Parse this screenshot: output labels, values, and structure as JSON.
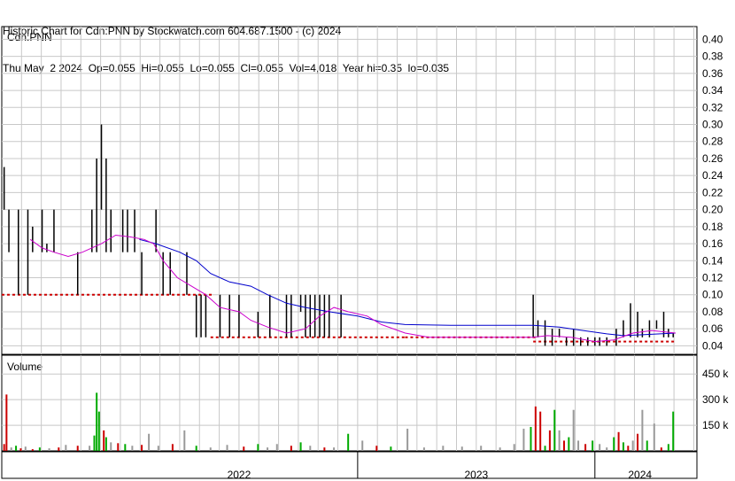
{
  "header": {
    "line1": "Historic Chart for Cdn:PNN by Stockwatch.com 604.687.1500 - (c) 2024",
    "line2": "Thu May  2 2024  Op=0.055  Hi=0.055  Lo=0.055  Cl=0.055  Vol=4,018  Year hi=0.35  lo=0.035"
  },
  "colors": {
    "grid": "#c8c8c8",
    "price_up": "#000000",
    "price_down": "#cc0000",
    "ma_short": "#cc00cc",
    "ma_long": "#0000cc",
    "vol_up": "#00aa00",
    "vol_down": "#cc0000",
    "vol_flat": "#999999"
  },
  "chart_data": [
    {
      "type": "line",
      "title": "Cdn:PNN",
      "y_ticks": [
        "0.40",
        "0.38",
        "0.36",
        "0.34",
        "0.32",
        "0.30",
        "0.28",
        "0.26",
        "0.24",
        "0.22",
        "0.20",
        "0.18",
        "0.16",
        "0.14",
        "0.12",
        "0.10",
        "0.08",
        "0.06",
        "0.04"
      ],
      "ylim": [
        0.03,
        0.415
      ],
      "xlim": [
        2021.5,
        2024.43
      ],
      "x_labels": [
        {
          "label": "2022",
          "center": 2022.5
        },
        {
          "label": "2023",
          "center": 2023.5
        },
        {
          "label": "2024",
          "center": 2024.19
        }
      ],
      "year_boundaries": [
        2023.0,
        2024.0
      ],
      "grid": true,
      "price_bars": [
        [
          2021.51,
          0.25,
          0.2
        ],
        [
          2021.53,
          0.2,
          0.15
        ],
        [
          2021.55,
          0.15,
          0.15
        ],
        [
          2021.57,
          0.2,
          0.1
        ],
        [
          2021.59,
          0.15,
          0.15
        ],
        [
          2021.61,
          0.2,
          0.1
        ],
        [
          2021.63,
          0.18,
          0.15
        ],
        [
          2021.65,
          0.15,
          0.15
        ],
        [
          2021.67,
          0.2,
          0.15
        ],
        [
          2021.69,
          0.16,
          0.15
        ],
        [
          2021.72,
          0.2,
          0.15
        ],
        [
          2021.74,
          0.15,
          0.15
        ],
        [
          2021.78,
          0.15,
          0.15
        ],
        [
          2021.82,
          0.15,
          0.1
        ],
        [
          2021.86,
          0.15,
          0.15
        ],
        [
          2021.88,
          0.2,
          0.15
        ],
        [
          2021.9,
          0.26,
          0.15
        ],
        [
          2021.92,
          0.3,
          0.2
        ],
        [
          2021.94,
          0.26,
          0.15
        ],
        [
          2021.96,
          0.2,
          0.15
        ],
        [
          2021.98,
          0.15,
          0.15
        ],
        [
          2022.01,
          0.2,
          0.15
        ],
        [
          2022.03,
          0.2,
          0.15
        ],
        [
          2022.06,
          0.2,
          0.15
        ],
        [
          2022.09,
          0.15,
          0.1
        ],
        [
          2022.12,
          0.15,
          0.15
        ],
        [
          2022.15,
          0.2,
          0.15
        ],
        [
          2022.18,
          0.15,
          0.1
        ],
        [
          2022.21,
          0.15,
          0.1
        ],
        [
          2022.24,
          0.15,
          0.15
        ],
        [
          2022.28,
          0.15,
          0.1
        ],
        [
          2022.32,
          0.1,
          0.05
        ],
        [
          2022.34,
          0.1,
          0.05
        ],
        [
          2022.36,
          0.1,
          0.05
        ],
        [
          2022.42,
          0.1,
          0.05
        ],
        [
          2022.46,
          0.1,
          0.05
        ],
        [
          2022.5,
          0.1,
          0.05
        ],
        [
          2022.58,
          0.08,
          0.05
        ],
        [
          2022.63,
          0.1,
          0.05
        ],
        [
          2022.7,
          0.1,
          0.05
        ],
        [
          2022.72,
          0.1,
          0.05
        ],
        [
          2022.76,
          0.1,
          0.08
        ],
        [
          2022.78,
          0.1,
          0.05
        ],
        [
          2022.8,
          0.1,
          0.05
        ],
        [
          2022.82,
          0.1,
          0.05
        ],
        [
          2022.84,
          0.1,
          0.05
        ],
        [
          2022.86,
          0.1,
          0.05
        ],
        [
          2022.88,
          0.1,
          0.05
        ],
        [
          2022.93,
          0.1,
          0.05
        ],
        [
          2023.74,
          0.1,
          0.05
        ],
        [
          2023.76,
          0.07,
          0.05
        ],
        [
          2023.79,
          0.07,
          0.04
        ],
        [
          2023.82,
          0.06,
          0.04
        ],
        [
          2023.85,
          0.06,
          0.05
        ],
        [
          2023.88,
          0.05,
          0.04
        ],
        [
          2023.91,
          0.06,
          0.04
        ],
        [
          2023.94,
          0.05,
          0.04
        ],
        [
          2023.97,
          0.05,
          0.04
        ],
        [
          2024.0,
          0.05,
          0.04
        ],
        [
          2024.02,
          0.05,
          0.04
        ],
        [
          2024.05,
          0.05,
          0.04
        ],
        [
          2024.09,
          0.06,
          0.04
        ],
        [
          2024.12,
          0.07,
          0.05
        ],
        [
          2024.15,
          0.09,
          0.05
        ],
        [
          2024.18,
          0.08,
          0.05
        ],
        [
          2024.2,
          0.06,
          0.05
        ],
        [
          2024.23,
          0.07,
          0.05
        ],
        [
          2024.26,
          0.07,
          0.06
        ],
        [
          2024.29,
          0.08,
          0.05
        ],
        [
          2024.31,
          0.06,
          0.05
        ],
        [
          2024.33,
          0.055,
          0.05
        ]
      ],
      "flat_closes": {
        "ranges": [
          [
            2021.5,
            2022.38,
            0.1
          ],
          [
            2022.38,
            2023.2,
            0.05
          ],
          [
            2023.2,
            2023.74,
            0.05
          ],
          [
            2023.74,
            2024.34,
            0.045
          ]
        ]
      },
      "ma_long": [
        [
          2022.08,
          0.165
        ],
        [
          2022.15,
          0.16
        ],
        [
          2022.25,
          0.15
        ],
        [
          2022.32,
          0.14
        ],
        [
          2022.38,
          0.125
        ],
        [
          2022.46,
          0.115
        ],
        [
          2022.55,
          0.11
        ],
        [
          2022.62,
          0.1
        ],
        [
          2022.7,
          0.09
        ],
        [
          2022.78,
          0.085
        ],
        [
          2022.88,
          0.08
        ],
        [
          2023.0,
          0.075
        ],
        [
          2023.1,
          0.068
        ],
        [
          2023.2,
          0.065
        ],
        [
          2023.4,
          0.064
        ],
        [
          2023.6,
          0.064
        ],
        [
          2023.74,
          0.064
        ],
        [
          2023.85,
          0.062
        ],
        [
          2023.95,
          0.058
        ],
        [
          2024.05,
          0.054
        ],
        [
          2024.12,
          0.052
        ],
        [
          2024.2,
          0.053
        ],
        [
          2024.34,
          0.055
        ]
      ],
      "ma_short": [
        [
          2021.62,
          0.165
        ],
        [
          2021.67,
          0.155
        ],
        [
          2021.72,
          0.15
        ],
        [
          2021.78,
          0.145
        ],
        [
          2021.84,
          0.15
        ],
        [
          2021.92,
          0.16
        ],
        [
          2021.98,
          0.17
        ],
        [
          2022.04,
          0.168
        ],
        [
          2022.1,
          0.165
        ],
        [
          2022.14,
          0.16
        ],
        [
          2022.18,
          0.14
        ],
        [
          2022.24,
          0.12
        ],
        [
          2022.3,
          0.11
        ],
        [
          2022.36,
          0.1
        ],
        [
          2022.42,
          0.085
        ],
        [
          2022.5,
          0.08
        ],
        [
          2022.55,
          0.07
        ],
        [
          2022.62,
          0.062
        ],
        [
          2022.7,
          0.055
        ],
        [
          2022.78,
          0.06
        ],
        [
          2022.84,
          0.075
        ],
        [
          2022.9,
          0.085
        ],
        [
          2022.96,
          0.08
        ],
        [
          2023.04,
          0.075
        ],
        [
          2023.1,
          0.065
        ],
        [
          2023.2,
          0.055
        ],
        [
          2023.3,
          0.05
        ],
        [
          2023.6,
          0.05
        ],
        [
          2023.74,
          0.05
        ],
        [
          2023.8,
          0.052
        ],
        [
          2023.9,
          0.05
        ],
        [
          2024.0,
          0.045
        ],
        [
          2024.08,
          0.047
        ],
        [
          2024.16,
          0.055
        ],
        [
          2024.24,
          0.058
        ],
        [
          2024.34,
          0.055
        ]
      ]
    },
    {
      "type": "bar",
      "title": "Volume",
      "y_ticks": [
        "450 k",
        "300 k",
        "150 k"
      ],
      "ylim": [
        0,
        560
      ],
      "xlim": [
        2021.5,
        2024.43
      ],
      "values": [
        [
          2021.51,
          40,
          "down"
        ],
        [
          2021.52,
          330,
          "down"
        ],
        [
          2021.54,
          20,
          "flat"
        ],
        [
          2021.56,
          30,
          "up"
        ],
        [
          2021.58,
          15,
          "down"
        ],
        [
          2021.6,
          25,
          "flat"
        ],
        [
          2021.63,
          10,
          "down"
        ],
        [
          2021.66,
          20,
          "up"
        ],
        [
          2021.7,
          15,
          "flat"
        ],
        [
          2021.74,
          20,
          "down"
        ],
        [
          2021.77,
          35,
          "flat"
        ],
        [
          2021.82,
          30,
          "down"
        ],
        [
          2021.87,
          30,
          "flat"
        ],
        [
          2021.89,
          90,
          "up"
        ],
        [
          2021.9,
          340,
          "up"
        ],
        [
          2021.91,
          230,
          "up"
        ],
        [
          2021.93,
          120,
          "down"
        ],
        [
          2021.94,
          80,
          "up"
        ],
        [
          2021.96,
          50,
          "flat"
        ],
        [
          2021.99,
          45,
          "down"
        ],
        [
          2022.02,
          40,
          "up"
        ],
        [
          2022.05,
          30,
          "flat"
        ],
        [
          2022.09,
          35,
          "down"
        ],
        [
          2022.12,
          100,
          "flat"
        ],
        [
          2022.16,
          30,
          "flat"
        ],
        [
          2022.22,
          40,
          "down"
        ],
        [
          2022.27,
          120,
          "flat"
        ],
        [
          2022.32,
          30,
          "up"
        ],
        [
          2022.38,
          20,
          "flat"
        ],
        [
          2022.45,
          35,
          "flat"
        ],
        [
          2022.52,
          25,
          "down"
        ],
        [
          2022.58,
          40,
          "up"
        ],
        [
          2022.62,
          20,
          "flat"
        ],
        [
          2022.66,
          40,
          "flat"
        ],
        [
          2022.72,
          30,
          "down"
        ],
        [
          2022.76,
          50,
          "up"
        ],
        [
          2022.8,
          30,
          "flat"
        ],
        [
          2022.86,
          20,
          "down"
        ],
        [
          2022.9,
          20,
          "flat"
        ],
        [
          2022.96,
          100,
          "up"
        ],
        [
          2023.02,
          60,
          "flat"
        ],
        [
          2023.08,
          30,
          "down"
        ],
        [
          2023.14,
          25,
          "up"
        ],
        [
          2023.21,
          130,
          "flat"
        ],
        [
          2023.28,
          20,
          "flat"
        ],
        [
          2023.36,
          30,
          "flat"
        ],
        [
          2023.44,
          25,
          "flat"
        ],
        [
          2023.52,
          30,
          "flat"
        ],
        [
          2023.6,
          20,
          "flat"
        ],
        [
          2023.66,
          40,
          "flat"
        ],
        [
          2023.7,
          130,
          "flat"
        ],
        [
          2023.73,
          140,
          "up"
        ],
        [
          2023.75,
          260,
          "down"
        ],
        [
          2023.77,
          230,
          "down"
        ],
        [
          2023.79,
          30,
          "up"
        ],
        [
          2023.81,
          120,
          "down"
        ],
        [
          2023.83,
          240,
          "up"
        ],
        [
          2023.85,
          120,
          "flat"
        ],
        [
          2023.87,
          60,
          "down"
        ],
        [
          2023.89,
          80,
          "up"
        ],
        [
          2023.91,
          240,
          "flat"
        ],
        [
          2023.93,
          60,
          "flat"
        ],
        [
          2023.96,
          40,
          "down"
        ],
        [
          2023.99,
          60,
          "up"
        ],
        [
          2024.02,
          40,
          "flat"
        ],
        [
          2024.05,
          20,
          "flat"
        ],
        [
          2024.08,
          80,
          "up"
        ],
        [
          2024.1,
          110,
          "down"
        ],
        [
          2024.12,
          50,
          "up"
        ],
        [
          2024.14,
          30,
          "down"
        ],
        [
          2024.16,
          60,
          "flat"
        ],
        [
          2024.18,
          100,
          "down"
        ],
        [
          2024.2,
          240,
          "flat"
        ],
        [
          2024.22,
          60,
          "up"
        ],
        [
          2024.25,
          160,
          "flat"
        ],
        [
          2024.28,
          20,
          "down"
        ],
        [
          2024.31,
          40,
          "up"
        ],
        [
          2024.33,
          230,
          "up"
        ]
      ]
    }
  ]
}
